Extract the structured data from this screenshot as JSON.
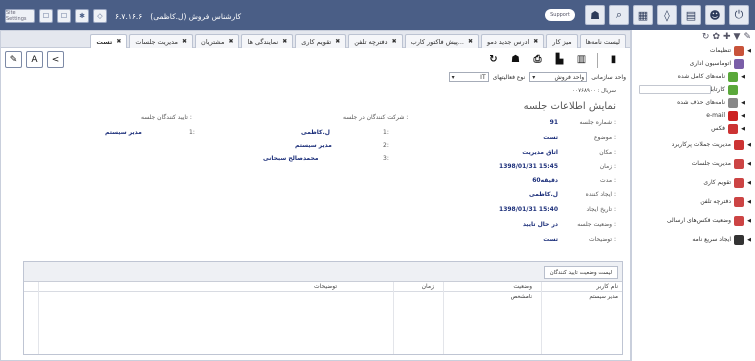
{
  "topbar": {
    "title": "کارشناس فروش (ل.کاظمی)",
    "version": "۶.۷.۱۶.۶",
    "left_ctl_label": "Site Settings",
    "user_label": "Support"
  },
  "tabs": [
    {
      "label": "لیست نامه‌ها",
      "active": false
    },
    {
      "label": "میز کار",
      "active": false
    },
    {
      "label": "ادرس جدید دمو",
      "active": false
    },
    {
      "label": "پیش فاکتور کارب...",
      "active": false
    },
    {
      "label": "دفترچه تلفن",
      "active": false
    },
    {
      "label": "تقویم کاری",
      "active": false
    },
    {
      "label": "نمایندگی ها",
      "active": false
    },
    {
      "label": "مشتریان",
      "active": false
    },
    {
      "label": "مدیریت جلسات",
      "active": false
    },
    {
      "label": "تست",
      "active": true
    }
  ],
  "filters": {
    "unit_label": "واحد سازمانی",
    "unit_value": "واحد فروش",
    "type_label": "نوع فعالیتهای",
    "type_value": "IT"
  },
  "record_count": "سریال : ۰۰۷۶۸۹۰۰",
  "pane_title": "نمایش اطلاعات جلسه",
  "details": [
    {
      "label": "شماره جلسه :",
      "value": "91"
    },
    {
      "label": "موضوع :",
      "value": "تست"
    },
    {
      "label": "مکان :",
      "value": "اتاق مدیریت"
    },
    {
      "label": "زمان :",
      "value": "1398/01/31 15:45"
    },
    {
      "label": "مدت :",
      "value": "60دقیقه"
    },
    {
      "label": "ایجاد کننده :",
      "value": "ل.کاظمی"
    },
    {
      "label": "تاریخ ایجاد :",
      "value": "1398/01/31 15:40"
    },
    {
      "label": "وضعیت جلسه :",
      "value": "در حال تایید"
    },
    {
      "label": "توضیحات :",
      "value": "تست"
    }
  ],
  "participants": {
    "title": "شرکت کنندگان در جلسه :",
    "rows": [
      {
        "idx": "1:",
        "name": "ل.کاظمی"
      },
      {
        "idx": "2:",
        "name": "مدیر سیستم"
      },
      {
        "idx": "3:",
        "name": "محمدصالح سبحانی"
      }
    ]
  },
  "approvers": {
    "title": "تایید کنندگان جلسه :",
    "rows": [
      {
        "idx": "1:",
        "name": "مدیر سیستم"
      }
    ]
  },
  "grid": {
    "tab_label": "لیست وضعیت تایید کنندگان",
    "columns": {
      "user": "نام کاربر",
      "status": "وضعیت",
      "time": "زمان",
      "notes": "توضیحات"
    },
    "rows": [
      {
        "user": "مدیر سیستم",
        "status": "نامشخص",
        "time": "",
        "notes": ""
      }
    ]
  },
  "sidebar": {
    "items": [
      {
        "label": "تنظیمات",
        "icon": "settings-icon",
        "color": "#c8533a"
      },
      {
        "label": "اتوماسیون اداری",
        "icon": "office-automation-icon",
        "color": "#7a5ea8"
      },
      {
        "label": "نامه‌های کامل شده",
        "icon": "completed-letters-icon",
        "color": "#5aa83a"
      },
      {
        "label": "کارتابل",
        "icon": "cartable-icon",
        "color": "#5aa83a"
      },
      {
        "label": "نامه‌های حذف شده",
        "icon": "trash-icon",
        "color": "#888888"
      },
      {
        "label": "e-mail",
        "icon": "email-icon",
        "color": "#cc2222"
      },
      {
        "label": "فکس",
        "icon": "fax-icon",
        "color": "#cc3333"
      },
      {
        "label": "مدیریت جملات پرکاربرد",
        "icon": "phrases-icon",
        "color": "#cc3333"
      },
      {
        "label": "مدیریت جلسات",
        "icon": "meetings-icon",
        "color": "#cc4444"
      },
      {
        "label": "تقویم کاری",
        "icon": "calendar-icon",
        "color": "#cc4444"
      },
      {
        "label": "دفترچه تلفن",
        "icon": "phonebook-icon",
        "color": "#cc4444"
      },
      {
        "label": "وضعیت فکس‌های ارسالی",
        "icon": "fax-status-icon",
        "color": "#cc4444"
      },
      {
        "label": "ایجاد سریع نامه",
        "icon": "quick-letter-icon",
        "color": "#333333"
      }
    ]
  }
}
